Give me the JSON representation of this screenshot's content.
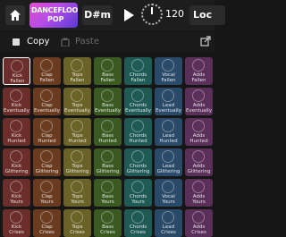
{
  "header": {
    "logo_line1": "DANCEFLOOR",
    "logo_line2": "POP",
    "key": "D#m",
    "tempo": "120",
    "loop_label": "Loc"
  },
  "toolbar": {
    "copy_label": "Copy",
    "paste_label": "Paste"
  },
  "colors": {
    "kick": "#6b2e2a",
    "clap": "#6b3b20",
    "tops": "#6a6226",
    "bass": "#3b5a22",
    "chords": "#1f5a55",
    "vocal": "#2a4a6a",
    "adds": "#5a2f5a"
  },
  "columns": [
    "Kick",
    "Clap",
    "Tops",
    "Bass",
    "Chords",
    "Vocal",
    "Adds"
  ],
  "rows": [
    [
      "Kick|Fallen",
      "Clap|Fallen",
      "Tops|Fallen",
      "Bass|Fallen",
      "Chords|Fallen",
      "Vocal|Fallen",
      "Adds|Fallen"
    ],
    [
      "Kick|Eventually",
      "Clap|Eventually",
      "Tops|Eventually",
      "Bass|Eventually",
      "Chords|Eventually",
      "Lead|Eventually",
      "Adds|Eventually"
    ],
    [
      "Kick|Hunted",
      "Clap|Hunted",
      "Tops|Hunted",
      "Bass|Hunted",
      "Chords|Hunted",
      "Lead|Hunted",
      "Adds|Hunted"
    ],
    [
      "Kick|Glittering",
      "Clap|Glittering",
      "Tops|Glittering",
      "Bass|Glittering",
      "Chords|Glittering",
      "Lead|Glittering",
      "Adds|Glittering"
    ],
    [
      "Kick|Yours",
      "Clap|Yours",
      "Tops|Yours",
      "Bass|Yours",
      "Chords|Yours",
      "Vocal|Yours",
      "Adds|Yours"
    ],
    [
      "Kick|Crises",
      "Clap|Crises",
      "Tops|Crises",
      "Bass|Crises",
      "Chords|Crises",
      "Lead|Crises",
      "Adds|Crises"
    ]
  ]
}
